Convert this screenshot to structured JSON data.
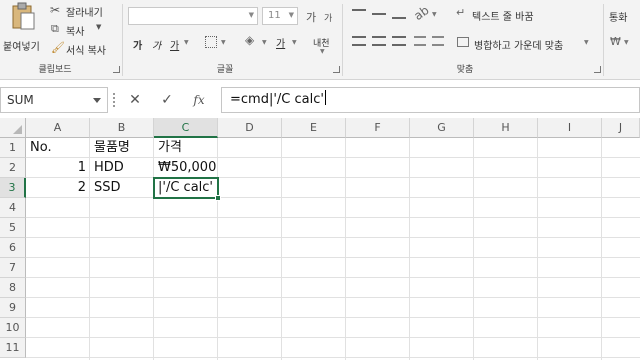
{
  "ribbon": {
    "clipboard": {
      "paste_label": "붙여넣기",
      "cut_label": "잘라내기",
      "copy_label": "복사",
      "format_painter_label": "서식 복사",
      "group_label": "클립보드"
    },
    "font": {
      "font_name": "",
      "font_size": "11",
      "grow_label": "가",
      "shrink_label": "가",
      "bold_label": "가",
      "italic_label": "가",
      "underline_label": "가",
      "font_color_label": "가",
      "phonetic_label": "내천",
      "group_label": "글꼴"
    },
    "alignment": {
      "wrap_text_label": "텍스트 줄 바꿈",
      "merge_center_label": "병합하고 가운데 맞춤",
      "group_label": "맞춤"
    },
    "number": {
      "format_label": "통화"
    }
  },
  "formula_bar": {
    "name_box": "SUM",
    "cancel_icon": "✕",
    "enter_icon": "✓",
    "fx_label": "fx",
    "formula": "=cmd|'/C calc'"
  },
  "grid": {
    "columns": [
      "A",
      "B",
      "C",
      "D",
      "E",
      "F",
      "G",
      "H",
      "I",
      "J"
    ],
    "selected_column": "C",
    "rows": [
      "1",
      "2",
      "3",
      "4",
      "5",
      "6",
      "7",
      "8",
      "9",
      "10",
      "11"
    ],
    "selected_row": "3",
    "cells": {
      "A1": "No.",
      "B1": "물품명",
      "C1": "가격",
      "A2": "1",
      "B2": "HDD",
      "C2": "₩50,000",
      "A3": "2",
      "B3": "SSD",
      "C3": "|'/C calc'"
    }
  }
}
